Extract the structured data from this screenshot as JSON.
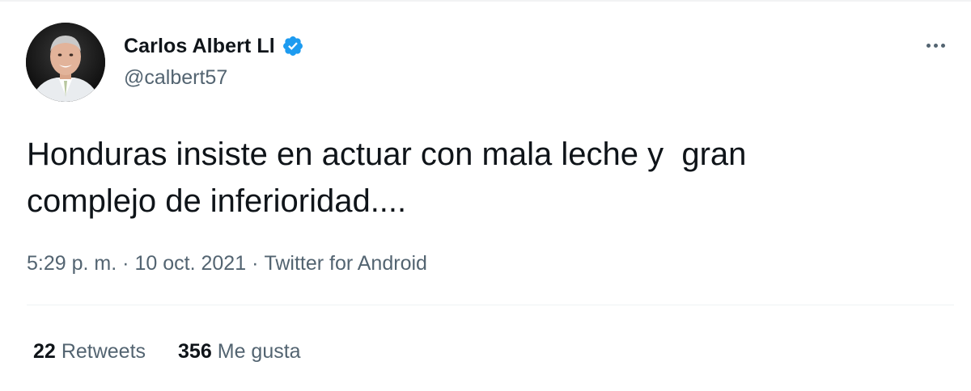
{
  "author": {
    "name": "Carlos Albert Ll",
    "handle": "@calbert57",
    "verified": true,
    "avatar_icon": "profile-photo",
    "verified_color": "#1d9bf0"
  },
  "tweet": {
    "text": "Honduras insiste en actuar con mala leche y  gran\ncomplejo de inferioridad....",
    "time": "5:29 p. m.",
    "separator": "·",
    "date": "10 oct. 2021",
    "source": "Twitter for Android"
  },
  "stats": {
    "retweets_count": "22",
    "retweets_label": "Retweets",
    "likes_count": "356",
    "likes_label": "Me gusta"
  },
  "icons": {
    "more": "more-horizontal-icon",
    "verified": "verified-badge-icon"
  },
  "colors": {
    "text_primary": "#0f1419",
    "text_secondary": "#536471",
    "accent": "#1d9bf0"
  }
}
